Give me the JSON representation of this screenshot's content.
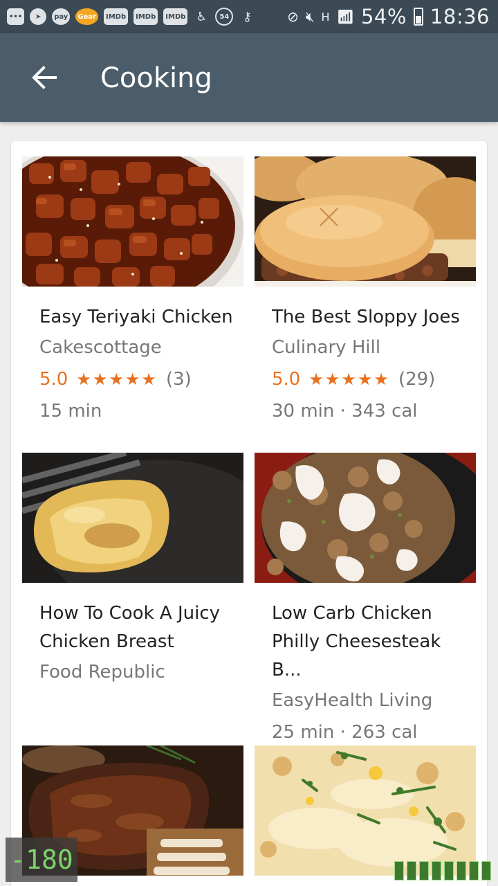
{
  "status_bar": {
    "icons": [
      "more-icon",
      "telegram-icon",
      "pay-icon",
      "gear-icon",
      "imdb-icon",
      "imdb-icon",
      "imdb-icon",
      "accessibility-icon",
      "notification-count-icon",
      "key-icon"
    ],
    "pay_label": "pay",
    "gear_label": "Gear",
    "imdb_label": "IMDb",
    "notification_count": "54",
    "network_label": "H",
    "battery": "54%",
    "time": "18:36"
  },
  "app_bar": {
    "title": "Cooking",
    "background": "#4b5d6a"
  },
  "recipes": [
    {
      "title": "Easy Teriyaki Chicken",
      "source": "Cakescottage",
      "rating": "5.0",
      "stars": "★★★★★",
      "reviews": "(3)",
      "meta": "15 min",
      "image": "teriyaki-chicken"
    },
    {
      "title": "The Best Sloppy Joes",
      "source": "Culinary Hill",
      "rating": "5.0",
      "stars": "★★★★★",
      "reviews": "(29)",
      "meta": "30 min · 343 cal",
      "image": "sloppy-joes"
    },
    {
      "title": "How To Cook A Juicy Chicken Breast",
      "source": "Food Republic",
      "image": "chicken-breast"
    },
    {
      "title": "Low Carb Chicken Philly Cheesesteak B...",
      "source": "EasyHealth Living",
      "meta": "25 min · 263 cal",
      "image": "philly-cheesesteak"
    },
    {
      "image": "prime-rib"
    },
    {
      "image": "cheesy-casserole"
    }
  ],
  "overlay": {
    "fps_value": "-180"
  },
  "colors": {
    "accent_orange": "#e8711e",
    "status_bar": "#3b4a55"
  }
}
